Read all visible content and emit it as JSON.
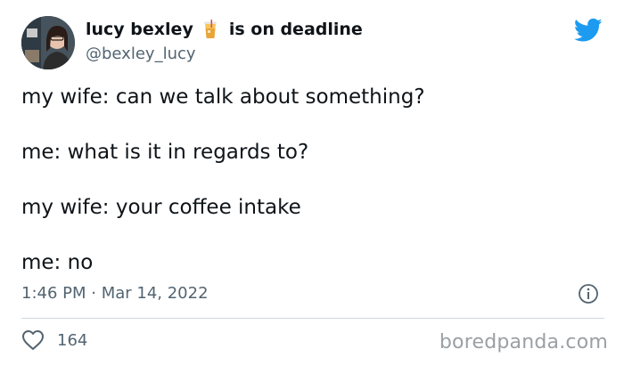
{
  "author": {
    "display_name": "lucy bexley",
    "status_text": "is on deadline",
    "status_icon": "iced-coffee-icon",
    "handle": "@bexley_lucy",
    "avatar": "profile-photo"
  },
  "tweet": {
    "lines": [
      "my wife: can we talk about something?",
      "me: what is it in regards to?",
      "my wife: your coffee intake",
      "me: no"
    ],
    "timestamp": "1:46 PM · Mar 14, 2022"
  },
  "actions": {
    "like_count": "164"
  },
  "icons": {
    "brand": "twitter-bird-icon",
    "info": "info-icon",
    "like": "heart-icon"
  },
  "colors": {
    "twitter_blue": "#1d9bf0",
    "text_primary": "#0f1419",
    "text_secondary": "#536471"
  },
  "watermark": "boredpanda.com"
}
